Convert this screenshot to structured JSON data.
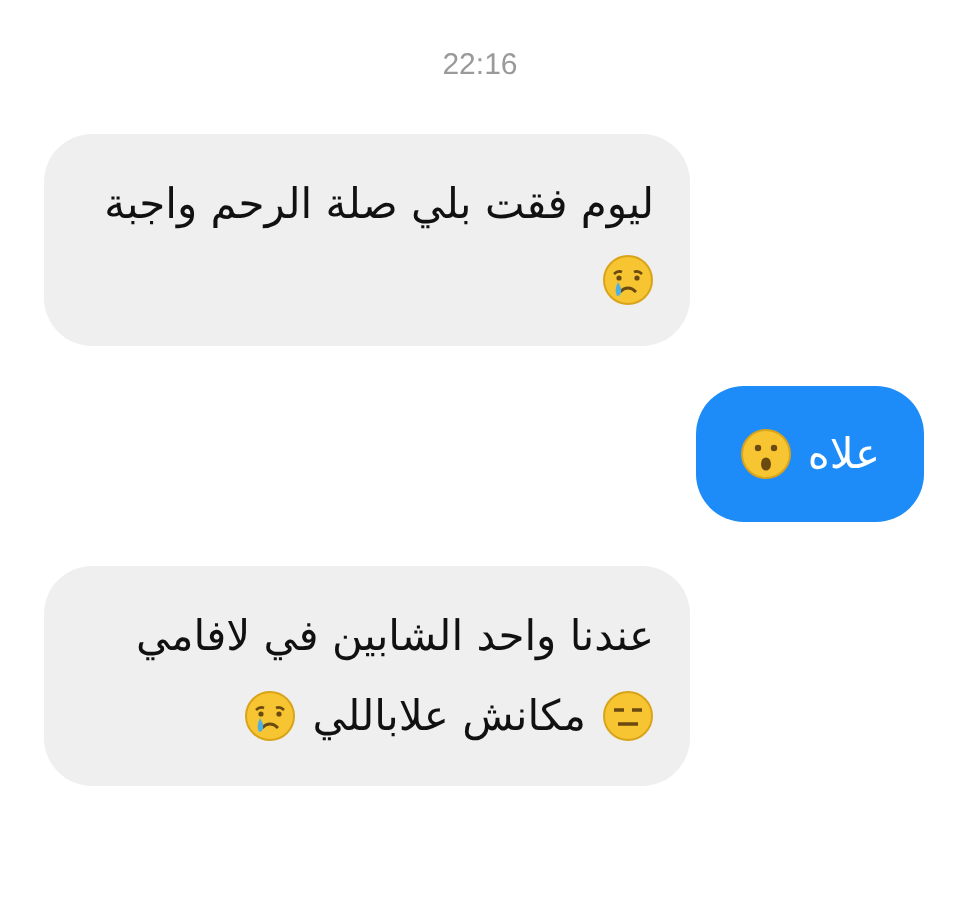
{
  "time": "22:16",
  "messages": [
    {
      "kind": "received",
      "lines": [
        [
          {
            "kind": "text",
            "text": "ليوم فقت بلي صلة الرحم واجبة"
          }
        ],
        [
          {
            "kind": "crying"
          }
        ]
      ]
    },
    {
      "kind": "sent",
      "lines": [
        [
          {
            "kind": "text",
            "text": "علاه"
          },
          {
            "kind": "surprised"
          }
        ]
      ]
    },
    {
      "kind": "received",
      "lines": [
        [
          {
            "kind": "text",
            "text": "عندنا واحد الشابين في لافامي"
          }
        ],
        [
          {
            "kind": "expressionless"
          },
          {
            "kind": "text",
            "text": "مكانش علاباللي"
          },
          {
            "kind": "crying"
          }
        ]
      ]
    }
  ]
}
